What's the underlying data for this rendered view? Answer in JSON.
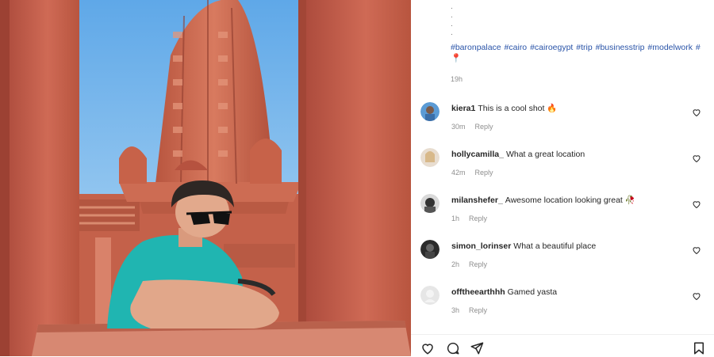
{
  "post": {
    "caption_dots": [
      ".",
      ".",
      ".",
      "."
    ],
    "hashtags": "#baronpalace #cairo #cairoegypt #trip #businesstrip #modelwork #",
    "pin_icon": "round-pushpin-icon",
    "time_ago": "19h"
  },
  "comments": [
    {
      "user": "kiera1",
      "text": "This is a cool shot 🔥",
      "time": "30m",
      "reply": "Reply"
    },
    {
      "user": "hollycamilla_",
      "text": "What a great location",
      "time": "42m",
      "reply": "Reply"
    },
    {
      "user": "milanshefer_",
      "text": "Awesome location looking great 🥀",
      "time": "1h",
      "reply": "Reply"
    },
    {
      "user": "simon_lorinser",
      "text": "What a beautiful place",
      "time": "2h",
      "reply": "Reply"
    },
    {
      "user": "offtheearthhh",
      "text": "Gamed yasta",
      "time": "3h",
      "reply": "Reply"
    }
  ],
  "actions": {
    "icons": [
      "heart-icon",
      "comment-icon",
      "share-icon",
      "bookmark-icon"
    ]
  },
  "colors": {
    "hashtag": "#2a54a8",
    "meta": "#8e8e8e",
    "building": "#c9654d",
    "sky": "#8ec3ec"
  }
}
